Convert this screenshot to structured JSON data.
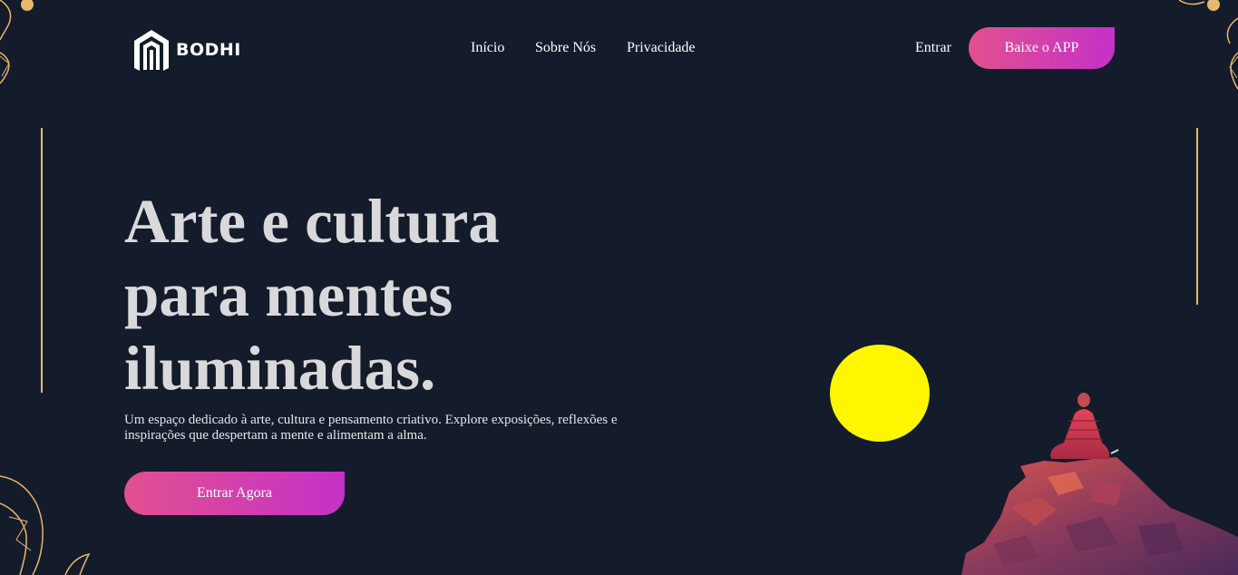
{
  "brand": {
    "name": "BODHI",
    "logo_icon": "bodhi-logo-icon"
  },
  "nav": {
    "items": [
      {
        "label": "Início"
      },
      {
        "label": "Sobre Nós"
      },
      {
        "label": "Privacidade"
      }
    ],
    "login_label": "Entrar",
    "download_button_label": "Baixe o APP"
  },
  "hero": {
    "title_lines": [
      "Arte e cultura",
      "para mentes",
      "iluminadas."
    ],
    "description": "Um espaço dedicado à arte, cultura e pensamento criativo. Explore exposições, reflexões e inspirações que despertam a mente e alimentam a alma.",
    "cta_label": "Entrar Agora"
  },
  "illustration": {
    "sun_icon": "sun-icon",
    "figure_icon": "meditating-figure-icon",
    "sun_color": "#fff600"
  },
  "colors": {
    "background": "#141b2a",
    "accent_gradient_start": "#e2508f",
    "accent_gradient_end": "#c431c8",
    "line_gold": "#e8b86b",
    "title_text": "#d9d9dc"
  }
}
